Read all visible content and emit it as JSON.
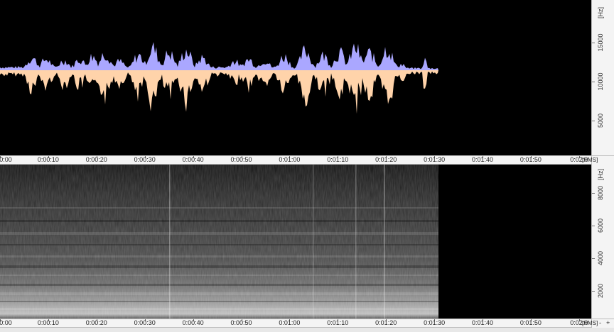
{
  "waveform": {
    "colors": {
      "upper": "#aaa7ff",
      "lower": "#ffd3aa",
      "background": "#000000"
    },
    "duration_label": "0:01:30",
    "frequency_axis": {
      "unit_label": "[Hz]",
      "ticks": [
        "15000",
        "10000",
        "5000"
      ]
    }
  },
  "spectrogram": {
    "frequency_axis": {
      "unit_label": "[Hz]",
      "ticks": [
        "8000",
        "6000",
        "4000",
        "2000"
      ]
    }
  },
  "timeline_top": {
    "unit_label": "[HMS]",
    "ticks": [
      "0:00",
      "0:00:10",
      "0:00:20",
      "0:00:30",
      "0:00:40",
      "0:00:50",
      "0:01:00",
      "0:01:10",
      "0:01:20",
      "0:01:30",
      "0:01:40",
      "0:01:50",
      "0:02:0"
    ]
  },
  "timeline_bottom": {
    "unit_label": "[HMS]",
    "ticks": [
      "0:00",
      "0:00:10",
      "0:00:20",
      "0:00:30",
      "0:00:40",
      "0:00:50",
      "0:01:00",
      "0:01:10",
      "0:01:20",
      "0:01:30",
      "0:01:40",
      "0:01:50",
      "0:02:0"
    ]
  },
  "zoom_controls": {
    "zoom_in": "+",
    "zoom_out": "-"
  }
}
